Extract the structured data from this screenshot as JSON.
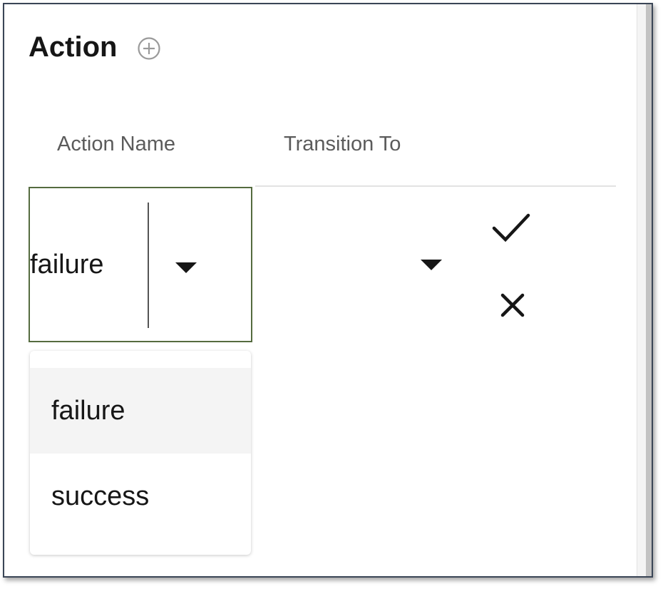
{
  "section": {
    "title": "Action",
    "add_icon": "plus-circle-icon"
  },
  "table": {
    "columns": [
      "Action Name",
      "Transition To"
    ]
  },
  "row": {
    "action_name_value": "failure",
    "transition_to_value": "",
    "confirm_icon": "checkmark-icon",
    "cancel_icon": "close-icon"
  },
  "dropdown": {
    "options": [
      "failure",
      "success"
    ],
    "highlighted": "failure"
  },
  "colors": {
    "field_border": "#556b3f",
    "highlight_bg": "#f4f4f4",
    "text": "#161616",
    "header_text": "#5b5b5b"
  }
}
